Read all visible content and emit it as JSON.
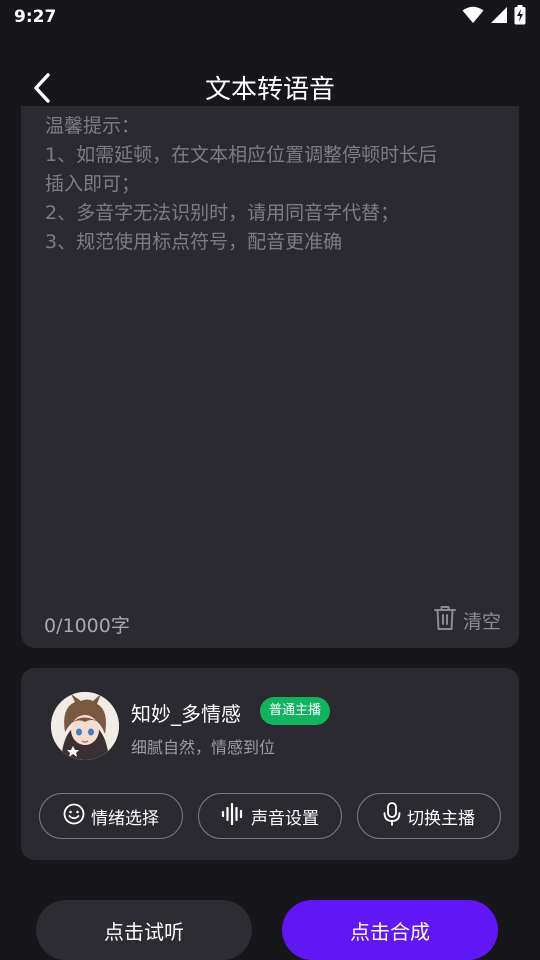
{
  "status_bar": {
    "time": "9:27",
    "icons": [
      "wifi-icon",
      "signal-icon",
      "battery-charging-icon"
    ]
  },
  "nav": {
    "title": "文本转语音",
    "back_icon": "chevron-left-icon"
  },
  "editor": {
    "value": "",
    "hint_lines": [
      "温馨提示：",
      "1、如需延顿，在文本相应位置调整停顿时长后",
      "插入即可；",
      "2、多音字无法识别时，请用同音字代替；",
      "3、规范使用标点符号，配音更准确"
    ],
    "counter": "0/1000字",
    "clear_label": "清空",
    "clear_icon": "trash-icon"
  },
  "voice": {
    "name": "知妙_多情感",
    "badge": "普通主播",
    "badge_color": "#12b35f",
    "description": "细腻自然，情感到位",
    "actions": [
      {
        "label": "情绪选择",
        "icon": "smiley-icon"
      },
      {
        "label": "声音设置",
        "icon": "waveform-icon"
      },
      {
        "label": "切换主播",
        "icon": "microphone-icon"
      }
    ]
  },
  "footer": {
    "listen_label": "点击试听",
    "synth_label": "点击合成",
    "synth_color": "#6116f5"
  }
}
